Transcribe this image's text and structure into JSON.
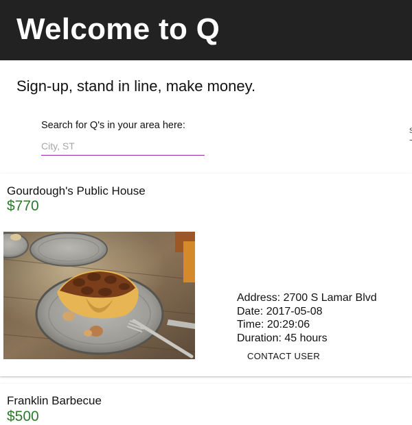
{
  "header": {
    "title": "Welcome to Q"
  },
  "tagline": "Sign-up, stand in line, make money.",
  "search": {
    "label": "Search for Q's in your area here:",
    "placeholder": "City, ST",
    "value": ""
  },
  "listings": [
    {
      "name": "Gourdough's Public House",
      "price": "$770",
      "address": "Address: 2700 S Lamar Blvd",
      "date": "Date: 2017-05-08",
      "time": "Time: 20:29:06",
      "duration": "Duration: 45 hours",
      "contact_label": "CONTACT USER",
      "image": "pecan-pie-donut-photo"
    },
    {
      "name": "Franklin Barbecue",
      "price": "$500"
    }
  ],
  "colors": {
    "header_bg": "#222222",
    "price": "#2a7a2a",
    "input_underline": "#9c27b0"
  }
}
